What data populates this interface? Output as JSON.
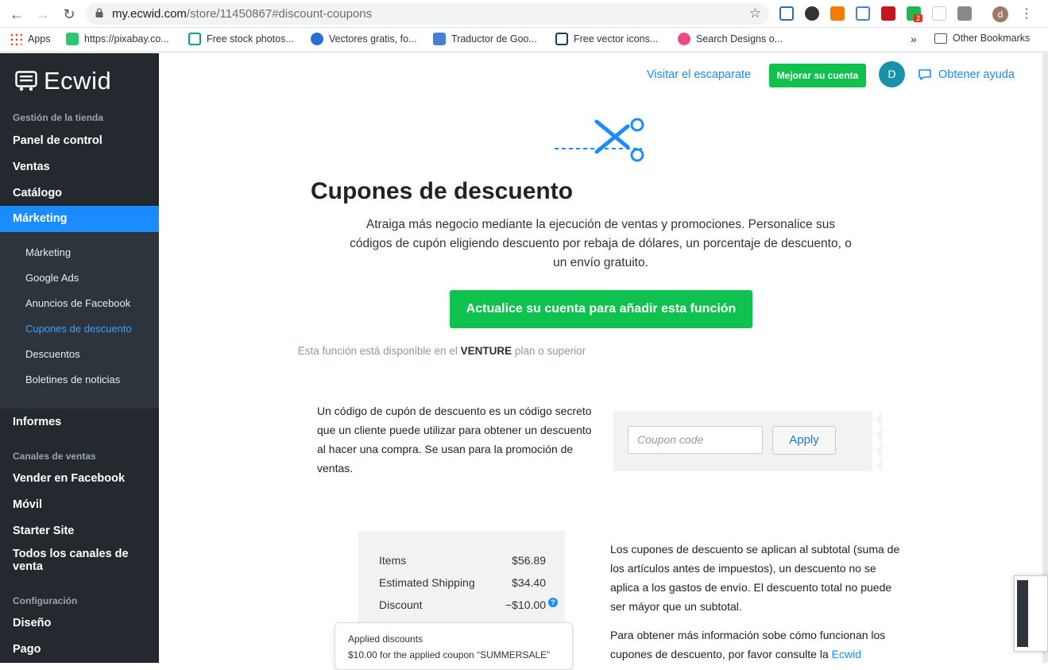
{
  "browser": {
    "url_host": "my.ecwid.com",
    "url_path": "/store/11450867#discount-coupons",
    "profile_initial": "d",
    "badge": "2",
    "bookmarks": [
      "Apps",
      "https://pixabay.co...",
      "Free stock photos...",
      "Vectores gratis, fo...",
      "Traductor de Goo...",
      "Free vector icons...",
      "Search Designs o..."
    ],
    "overflow": "»",
    "other_bookmarks": "Other Bookmarks"
  },
  "sidebar": {
    "brand": "Ecwid",
    "store_section": "Gestión de la tienda",
    "main_items": [
      "Panel de control",
      "Ventas",
      "Catálogo",
      "Márketing"
    ],
    "marketing_sub": [
      "Márketing",
      "Google Ads",
      "Anuncios de Facebook",
      "Cupones de descuento",
      "Descuentos",
      "Boletines de noticias"
    ],
    "reports": "Informes",
    "channels_section": "Canales de ventas",
    "channels": [
      "Vender en Facebook",
      "Móvil",
      "Starter Site",
      "Todos los canales de venta"
    ],
    "config_section": "Configuración",
    "config": [
      "Diseño",
      "Pago"
    ]
  },
  "topbar": {
    "visit_store": "Visitar el escaparate",
    "upgrade": "Mejorar su cuenta",
    "avatar_initial": "D",
    "help": "Obtener ayuda"
  },
  "main": {
    "title": "Cupones de descuento",
    "lead": "Atraiga más negocio mediante la ejecución de ventas y promociones. Personalice sus códigos de cupón eligiendo descuento por rebaja de dólares, un porcentaje de descuento, o un envío gratuito.",
    "cta": "Actualice su cuenta para añadir esta función",
    "plan_prefix": "Esta función está disponible en el",
    "plan_name": "VENTURE",
    "plan_suffix": "plan o superior",
    "para1": "Un código de cupón de descuento es un código secreto que un cliente puede utilizar para obtener un descuento al hacer una compra. Se usan para la promoción de ventas.",
    "coupon_placeholder": "Coupon code",
    "apply": "Apply",
    "receipt": {
      "items_label": "Items",
      "items_value": "$56.89",
      "shipping_label": "Estimated Shipping",
      "shipping_value": "$34.40",
      "discount_label": "Discount",
      "discount_value": "−$10.00"
    },
    "tooltip_title": "Applied discounts",
    "tooltip_body": "$10.00 for the applied coupon “SUMMERSALE”",
    "para2": "Los cupones de descuento se aplican al subtotal (suma de los artículos antes de impuestos), un descuento no se aplica a los gastos de envío. El descuento total no puede ser máyor que un subtotal.",
    "para3_prefix": "Para obtener más información sobe cómo funcionan los cupones de descuento, por favor consulte la",
    "para3_link": "Ecwid"
  },
  "colors": {
    "accent": "#1a8cff",
    "green": "#0fc24d",
    "sidebar": "#23292f"
  }
}
